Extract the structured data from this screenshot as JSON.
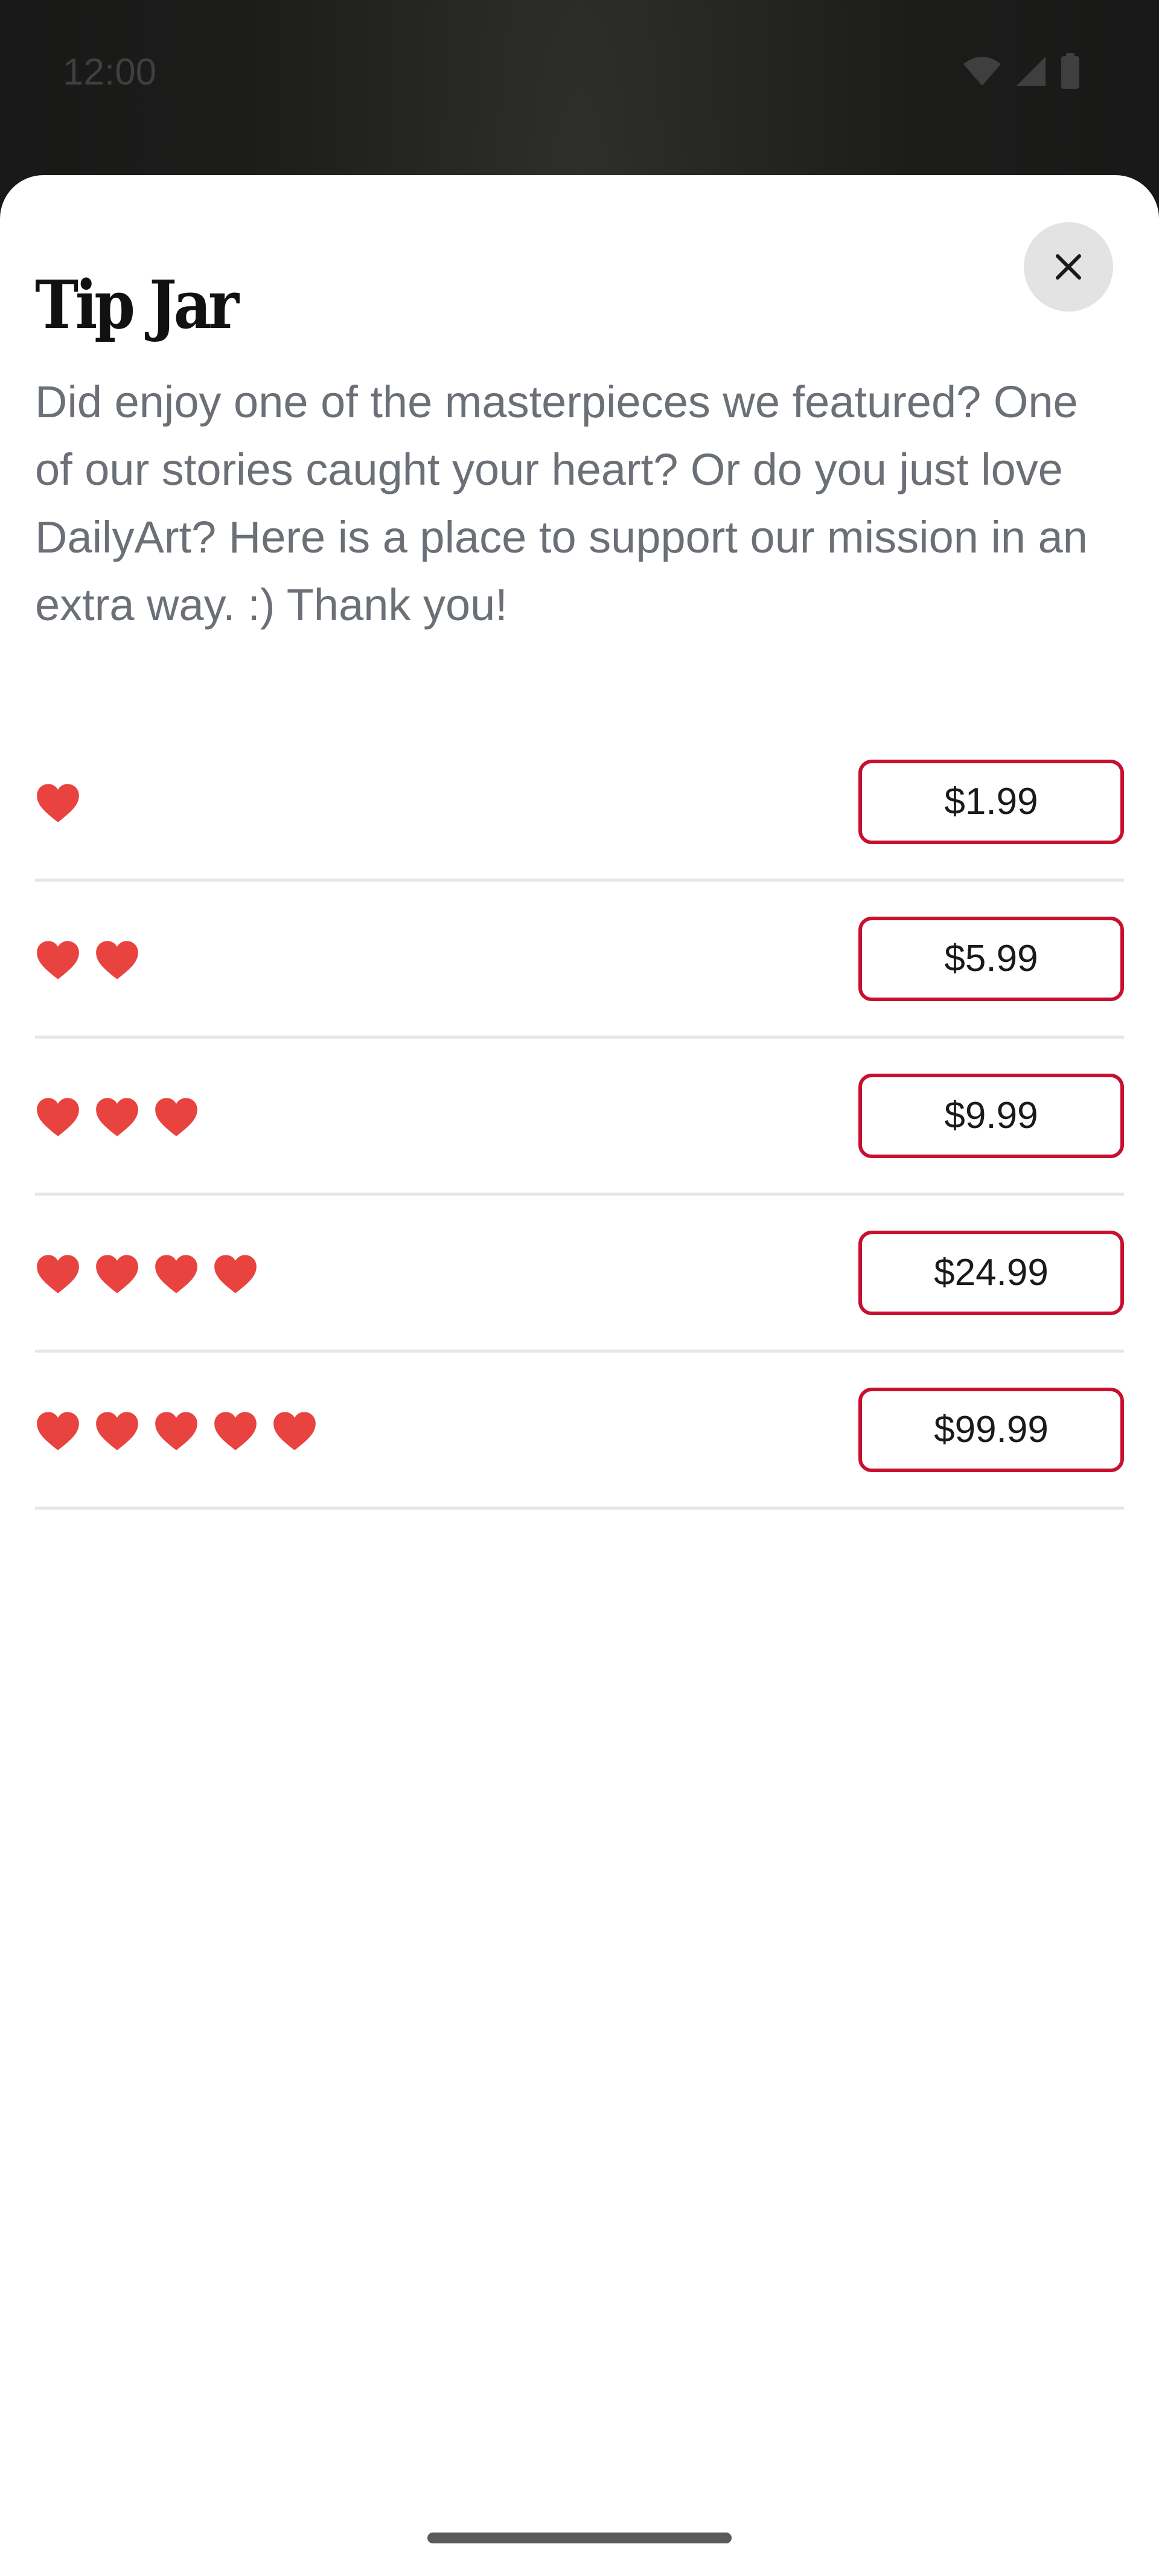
{
  "status_bar": {
    "time": "12:00",
    "icons": [
      "wifi-icon",
      "cellular-signal-icon",
      "battery-icon"
    ]
  },
  "sheet": {
    "close_icon": "close-icon",
    "title": "Tip Jar",
    "description": "Did enjoy one of the masterpieces we featured? One of our stories caught your heart? Or do you just love DailyArt? Here is a place to support our mission in an extra way. :) Thank you!",
    "tiers": [
      {
        "hearts": 1,
        "price": "$1.99"
      },
      {
        "hearts": 2,
        "price": "$5.99"
      },
      {
        "hearts": 3,
        "price": "$9.99"
      },
      {
        "hearts": 4,
        "price": "$24.99"
      },
      {
        "hearts": 5,
        "price": "$99.99"
      }
    ]
  },
  "colors": {
    "accent": "#c8102e",
    "heart": "#e8433f",
    "text_secondary": "#6b6f76",
    "close_bg": "#e3e3e3"
  }
}
